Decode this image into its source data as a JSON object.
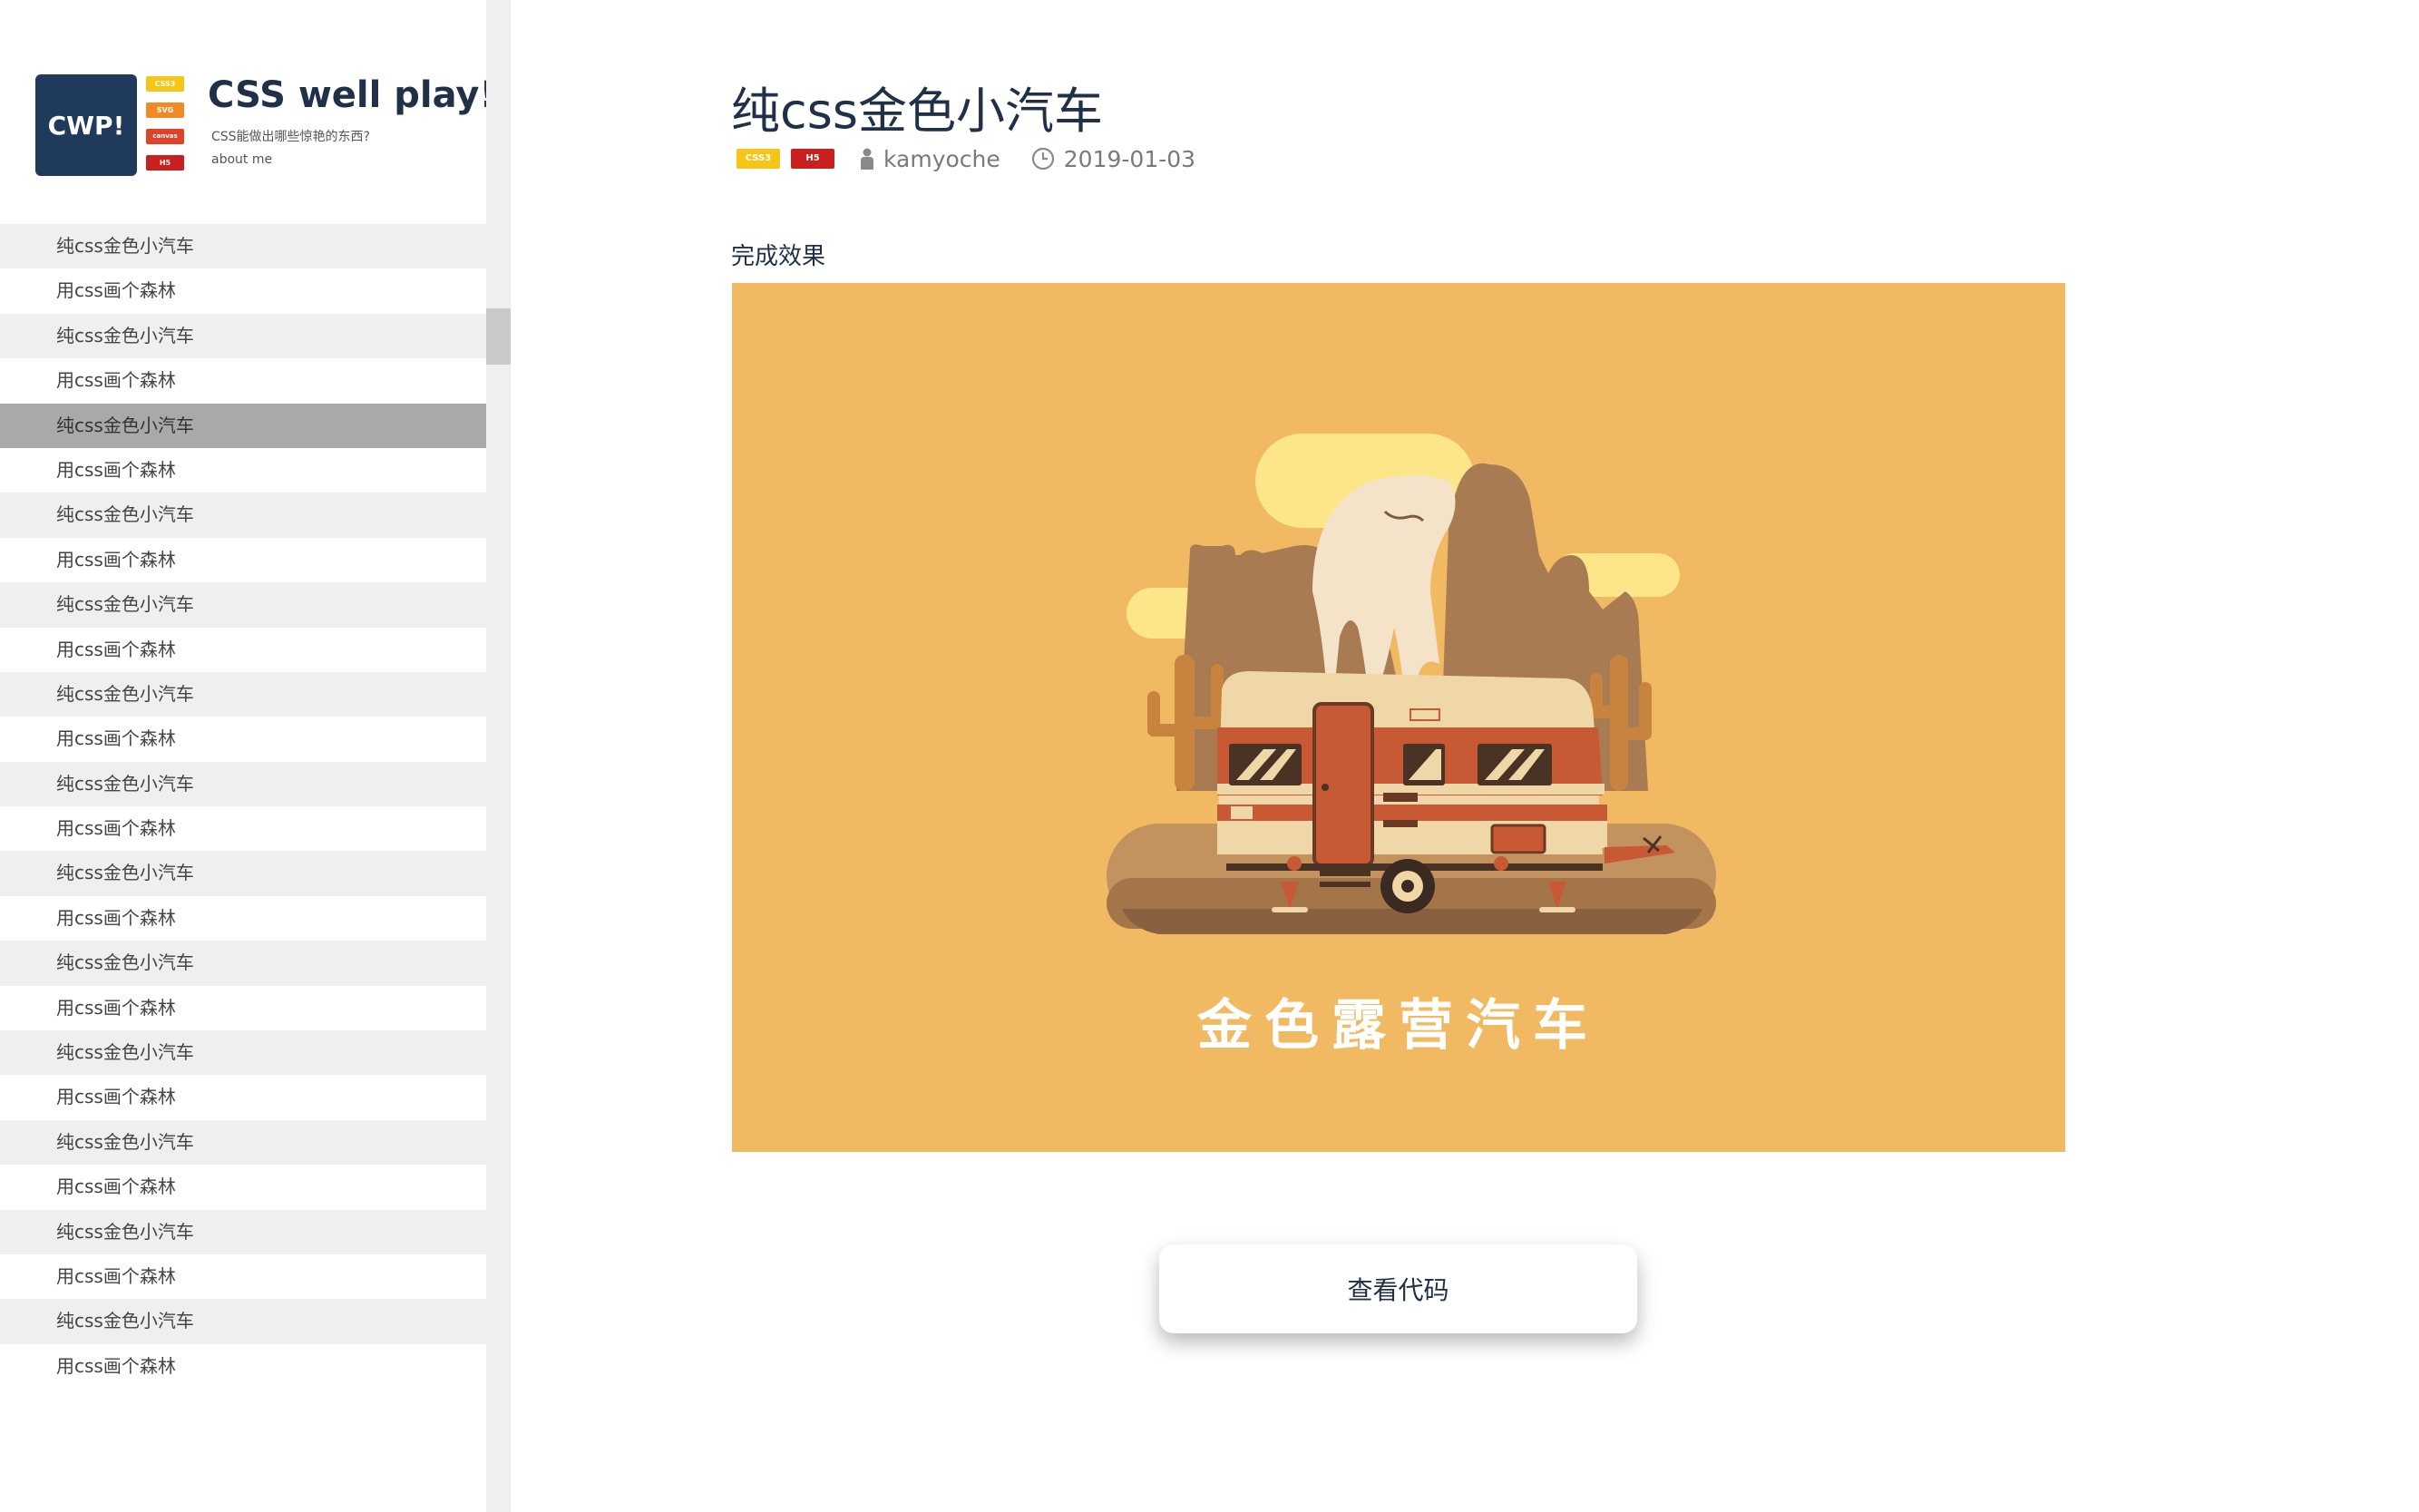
{
  "brand": {
    "logo_text": "CWP!",
    "badges": [
      {
        "label": "CSS3",
        "color": "#f5c518"
      },
      {
        "label": "SVG",
        "color": "#f08a24"
      },
      {
        "label": "canvas",
        "color": "#e0432b"
      },
      {
        "label": "H5",
        "color": "#c81f1f"
      }
    ],
    "title": "CSS well play!",
    "subtitle": "CSS能做出哪些惊艳的东西?",
    "about_link": "about me"
  },
  "sidebar": {
    "items": [
      {
        "label": "纯css金色小汽车"
      },
      {
        "label": "用css画个森林"
      },
      {
        "label": "纯css金色小汽车"
      },
      {
        "label": "用css画个森林"
      },
      {
        "label": "纯css金色小汽车",
        "active": true
      },
      {
        "label": "用css画个森林"
      },
      {
        "label": "纯css金色小汽车"
      },
      {
        "label": "用css画个森林"
      },
      {
        "label": "纯css金色小汽车"
      },
      {
        "label": "用css画个森林"
      },
      {
        "label": "纯css金色小汽车"
      },
      {
        "label": "用css画个森林"
      },
      {
        "label": "纯css金色小汽车"
      },
      {
        "label": "用css画个森林"
      },
      {
        "label": "纯css金色小汽车"
      },
      {
        "label": "用css画个森林"
      },
      {
        "label": "纯css金色小汽车"
      },
      {
        "label": "用css画个森林"
      },
      {
        "label": "纯css金色小汽车"
      },
      {
        "label": "用css画个森林"
      },
      {
        "label": "纯css金色小汽车"
      },
      {
        "label": "用css画个森林"
      },
      {
        "label": "纯css金色小汽车"
      },
      {
        "label": "用css画个森林"
      },
      {
        "label": "纯css金色小汽车"
      },
      {
        "label": "用css画个森林"
      }
    ]
  },
  "post": {
    "title": "纯css金色小汽车",
    "tags": [
      {
        "label": "CSS3",
        "color": "#f5c518"
      },
      {
        "label": "H5",
        "color": "#c81f1f"
      }
    ],
    "author": "kamyoche",
    "date": "2019-01-03",
    "section_label": "完成效果",
    "preview_caption": "金色露营汽车",
    "view_code_button": "查看代码"
  },
  "colors": {
    "preview_bg": "#f2b963",
    "logo_bg": "#1f3a5a",
    "title_color": "#1f3048"
  },
  "icons": {
    "author": "user-icon",
    "date": "clock-icon"
  }
}
